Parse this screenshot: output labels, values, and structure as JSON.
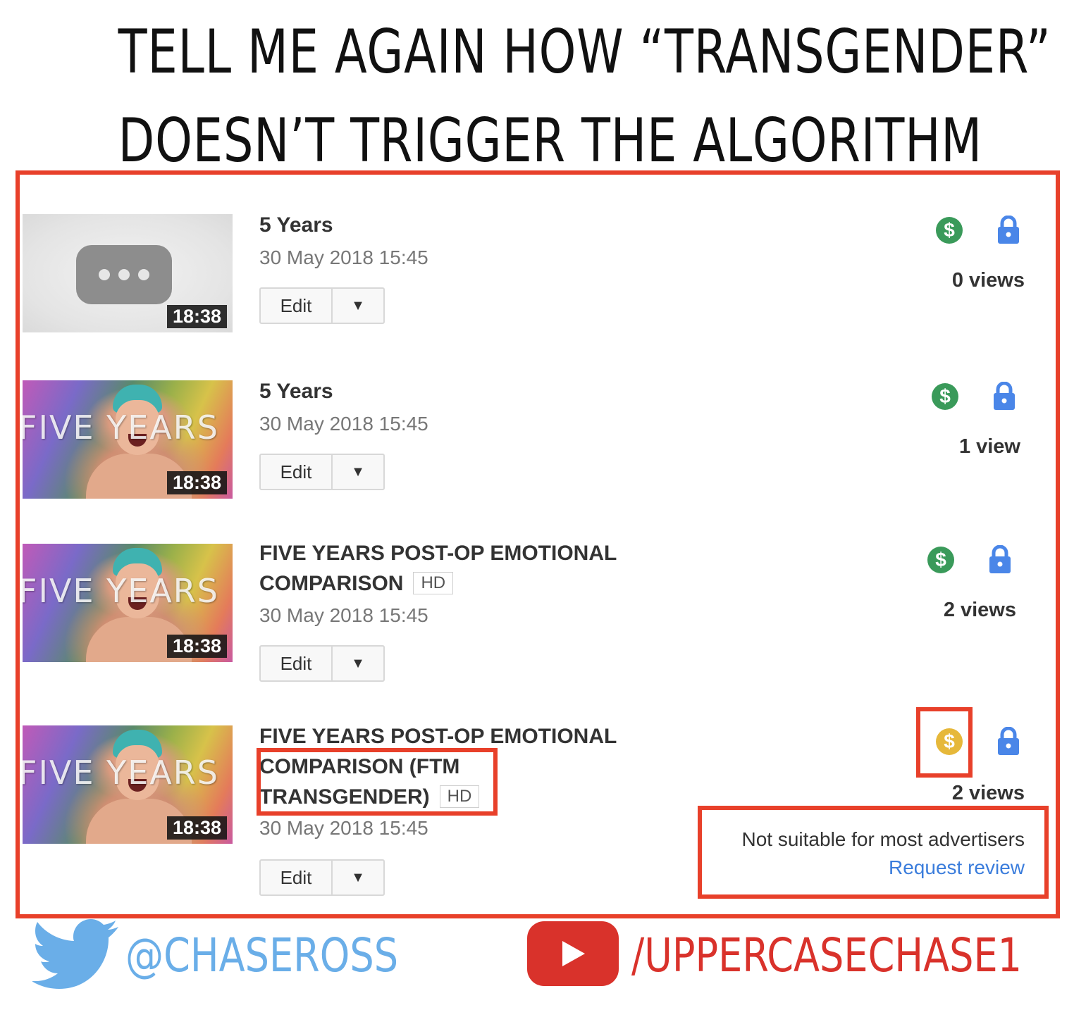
{
  "headline": {
    "line1": "TELL ME AGAIN HOW “TRANSGENDER”",
    "line2": "DOESN’T TRIGGER THE ALGORITHM"
  },
  "colors": {
    "highlight_red": "#e8402a",
    "monetized_green": "#3a9a5a",
    "limited_yellow": "#e6b83a",
    "lock_blue": "#4a86e8",
    "link_blue": "#3b7ddc",
    "twitter_blue": "#6aaee8",
    "youtube_red": "#d9322b"
  },
  "videos": [
    {
      "thumbnail": "processing-placeholder",
      "duration": "18:38",
      "title": "5 Years",
      "hd": "",
      "date": "30 May 2018 15:45",
      "edit_label": "Edit",
      "monetization_icon": "dollar-green-icon",
      "privacy_icon": "lock-icon",
      "views": "0 views"
    },
    {
      "thumbnail": "five-years-photo",
      "thumbnail_text": "FIVE YEARS",
      "duration": "18:38",
      "title": "5 Years",
      "hd": "",
      "date": "30 May 2018 15:45",
      "edit_label": "Edit",
      "monetization_icon": "dollar-green-icon",
      "privacy_icon": "lock-icon",
      "views": "1 view"
    },
    {
      "thumbnail": "five-years-photo",
      "thumbnail_text": "FIVE YEARS",
      "duration": "18:38",
      "title_line1": "FIVE YEARS POST-OP EMOTIONAL",
      "title_line2": "COMPARISON",
      "hd": "HD",
      "date": "30 May 2018 15:45",
      "edit_label": "Edit",
      "monetization_icon": "dollar-green-icon",
      "privacy_icon": "lock-icon",
      "views": "2 views"
    },
    {
      "thumbnail": "five-years-photo",
      "thumbnail_text": "FIVE YEARS",
      "duration": "18:38",
      "title_line1": "FIVE YEARS POST-OP EMOTIONAL",
      "title_line2": "COMPARISON (FTM",
      "title_line3": "TRANSGENDER)",
      "hd": "HD",
      "date": "30 May 2018 15:45",
      "edit_label": "Edit",
      "monetization_icon": "dollar-yellow-icon",
      "privacy_icon": "lock-icon",
      "views": "2 views",
      "ad_status": "Not suitable for most advertisers",
      "ad_action": "Request review"
    }
  ],
  "footer": {
    "twitter_handle": "@CHASEROSS",
    "youtube_channel": "/UPPERCASECHASE1"
  }
}
